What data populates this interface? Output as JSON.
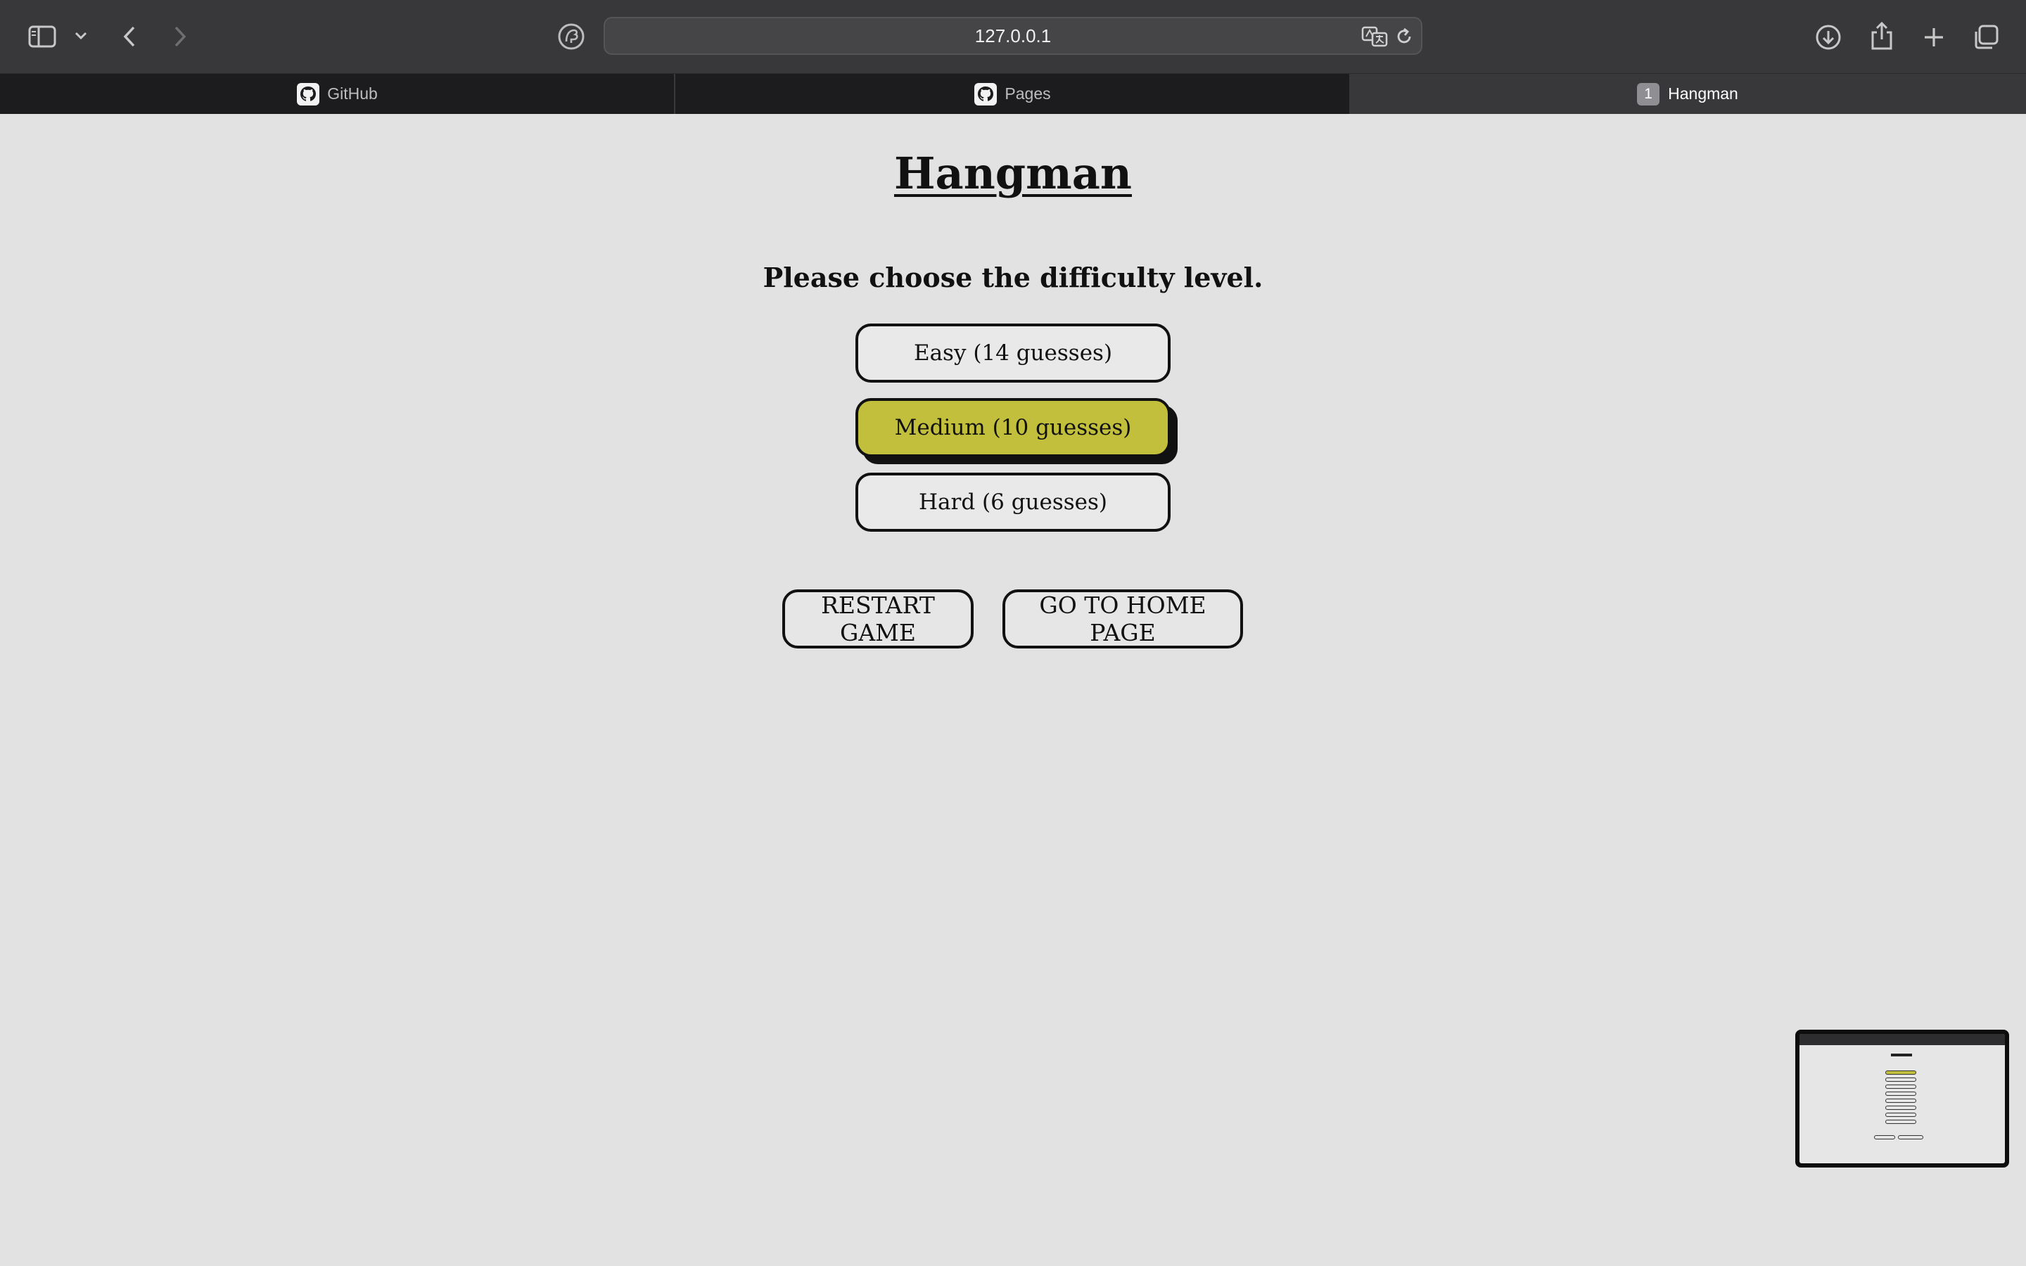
{
  "browser": {
    "url": "127.0.0.1",
    "icons": {
      "sidebar": "sidebar-icon",
      "chevron": "chevron-down-icon",
      "back": "back-arrow-icon",
      "forward": "forward-arrow-icon",
      "privacy": "privacy-shield-icon",
      "translate": "translate-icon",
      "reload": "reload-icon",
      "download": "download-icon",
      "share": "share-icon",
      "new_tab": "plus-icon",
      "tab_overview": "tab-overview-icon"
    },
    "tabs": [
      {
        "label": "GitHub",
        "icon": "github-icon",
        "active": false
      },
      {
        "label": "Pages",
        "icon": "github-icon",
        "active": false
      },
      {
        "label": "Hangman",
        "badge": "1",
        "active": true
      }
    ]
  },
  "page": {
    "title": "Hangman",
    "prompt": "Please choose the difficulty level.",
    "difficulty_options": [
      {
        "label": "Easy (14 guesses)",
        "selected": false
      },
      {
        "label": "Medium (10 guesses)",
        "selected": true
      },
      {
        "label": "Hard (6 guesses)",
        "selected": false
      }
    ],
    "actions": {
      "restart": "RESTART GAME",
      "home": "GO TO HOME PAGE"
    }
  },
  "colors": {
    "selected_button": "#c2bf3c",
    "page_background": "#e2e2e2",
    "toolbar": "#38383a",
    "tab_bar": "#1c1c1e"
  }
}
